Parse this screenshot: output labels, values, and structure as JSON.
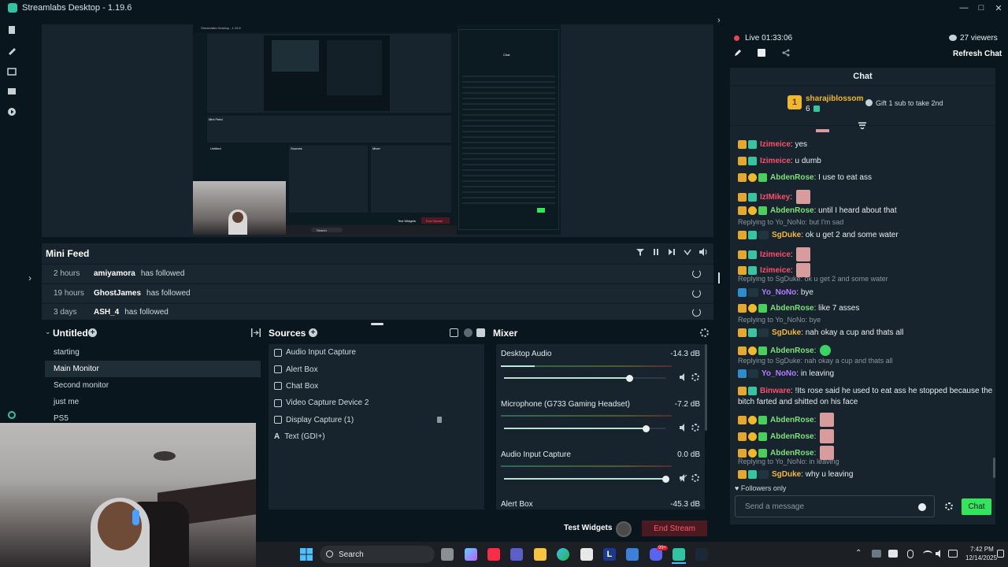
{
  "window": {
    "title": "Streamlabs Desktop - 1.19.6"
  },
  "preview": {
    "nested_title": "Streamlabs Desktop - 1.19.6",
    "nested_minifeed_title": "Mini Feed",
    "nested_scenes_title": "Untitled",
    "nested_sources_title": "Sources",
    "nested_mixer_title": "Mixer",
    "nested_chat_title": "Chat",
    "nested_search": "Search",
    "nested_test_widgets": "Test Widgets",
    "nested_end_stream": "End Stream"
  },
  "minifeed": {
    "title": "Mini Feed",
    "rows": [
      {
        "time": "2 hours",
        "user": "amiyamora",
        "action": "has followed"
      },
      {
        "time": "19 hours",
        "user": "GhostJames",
        "action": "has followed"
      },
      {
        "time": "3 days",
        "user": "ASH_4",
        "action": "has followed"
      }
    ]
  },
  "scenes": {
    "title": "Untitled",
    "items": [
      "starting",
      "Main Monitor",
      "Second monitor",
      "just me",
      "PS5"
    ],
    "selected": "Main Monitor"
  },
  "sources": {
    "title": "Sources",
    "items": [
      "Audio Input Capture",
      "Alert Box",
      "Chat Box",
      "Video Capture Device 2",
      "Display Capture (1)",
      "Text (GDI+)"
    ]
  },
  "mixer": {
    "title": "Mixer",
    "channels": [
      {
        "name": "Desktop Audio",
        "db": "-14.3 dB",
        "volume": 0.78,
        "level": 0.2
      },
      {
        "name": "Microphone (G733 Gaming Headset)",
        "db": "-7.2 dB",
        "volume": 0.88,
        "level": 0.0
      },
      {
        "name": "Audio Input Capture",
        "db": "0.0 dB",
        "volume": 1.0,
        "level": 0.0
      },
      {
        "name": "Alert Box",
        "db": "-45.3 dB",
        "volume": 0.1,
        "level": 0.0
      }
    ]
  },
  "bottombar": {
    "test_widgets": "Test Widgets",
    "end_stream": "End Stream"
  },
  "stream": {
    "live_label": "Live",
    "live_time": "01:33:06",
    "viewers": "27 viewers",
    "refresh_chat": "Refresh Chat"
  },
  "chat": {
    "title": "Chat",
    "top_user": "sharajiblossom",
    "top_rank": "1",
    "top_count": "6",
    "gift_text": "Gift 1 sub to take 2nd",
    "followers_only": "Followers only",
    "input_placeholder": "Send a message",
    "send_label": "Chat",
    "messages": [
      {
        "user": "Izimeice",
        "color": "#ff4d6d",
        "text": "yes",
        "badges": [
          "crown",
          "prime"
        ]
      },
      {
        "user": "Izimeice",
        "color": "#ff4d6d",
        "text": "u dumb",
        "badges": [
          "crown",
          "prime"
        ]
      },
      {
        "user": "AbdenRose",
        "color": "#7fe07a",
        "text": "I use to eat ass",
        "badges": [
          "crown",
          "gold",
          "green"
        ]
      },
      {
        "user": "IzIMikey",
        "color": "#ff4d6d",
        "text": "",
        "badges": [
          "crown",
          "prime"
        ],
        "emote": true
      },
      {
        "user": "AbdenRose",
        "color": "#7fe07a",
        "text": "until I heard about that",
        "badges": [
          "crown",
          "gold",
          "green"
        ]
      },
      {
        "user": "SgDuke",
        "color": "#f5b83d",
        "text": "ok u get 2 and some water",
        "badges": [
          "crown",
          "prime",
          "sys"
        ],
        "reply": "Replying to Yo_NoNo: but I'm sad"
      },
      {
        "user": "Izimeice",
        "color": "#ff4d6d",
        "text": "",
        "badges": [
          "crown",
          "prime"
        ],
        "emote": true
      },
      {
        "user": "Izimeice",
        "color": "#ff4d6d",
        "text": "",
        "badges": [
          "crown",
          "prime"
        ],
        "emote": true
      },
      {
        "user": "Yo_NoNo",
        "color": "#b77cff",
        "text": "bye",
        "badges": [
          "blue",
          "sys"
        ],
        "reply": "Replying to SgDuke: ok u get 2 and some water"
      },
      {
        "user": "AbdenRose",
        "color": "#7fe07a",
        "text": "like 7 asses",
        "badges": [
          "crown",
          "gold",
          "green"
        ]
      },
      {
        "user": "SgDuke",
        "color": "#f5b83d",
        "text": "nah okay a cup and thats all",
        "badges": [
          "crown",
          "prime",
          "sys"
        ],
        "reply": "Replying to Yo_NoNo: bye"
      },
      {
        "user": "AbdenRose",
        "color": "#7fe07a",
        "text": "",
        "badges": [
          "crown",
          "gold",
          "green"
        ],
        "emote": true
      },
      {
        "user": "Yo_NoNo",
        "color": "#b77cff",
        "text": "in leaving",
        "badges": [
          "blue",
          "sys"
        ],
        "reply": "Replying to SgDuke: nah okay a cup and thats all"
      },
      {
        "user": "Binware",
        "color": "#ff4d6d",
        "text": "!Its rose said he used to eat ass he stopped because the",
        "text2": "bitch farted and shitted on his face",
        "badges": [
          "crown",
          "prime"
        ]
      },
      {
        "user": "AbdenRose",
        "color": "#7fe07a",
        "text": "",
        "badges": [
          "crown",
          "gold",
          "green"
        ],
        "emote": true
      },
      {
        "user": "AbdenRose",
        "color": "#7fe07a",
        "text": "",
        "badges": [
          "crown",
          "gold",
          "green"
        ],
        "emote": true
      },
      {
        "user": "AbdenRose",
        "color": "#7fe07a",
        "text": "",
        "badges": [
          "crown",
          "gold",
          "green"
        ],
        "emote": true
      },
      {
        "user": "SgDuke",
        "color": "#f5b83d",
        "text": "why u leaving",
        "badges": [
          "crown",
          "prime",
          "sys"
        ],
        "reply": "Replying to Yo_NoNo: in leaving"
      }
    ]
  },
  "taskbar": {
    "search": "Search",
    "time": "7:42 PM",
    "date": "12/14/2025",
    "notification_count": "99+"
  },
  "colors": {
    "accent": "#31c3a2",
    "live": "#e84554",
    "end_stream": "#ff5b6b",
    "chat_button": "#32e55c"
  }
}
